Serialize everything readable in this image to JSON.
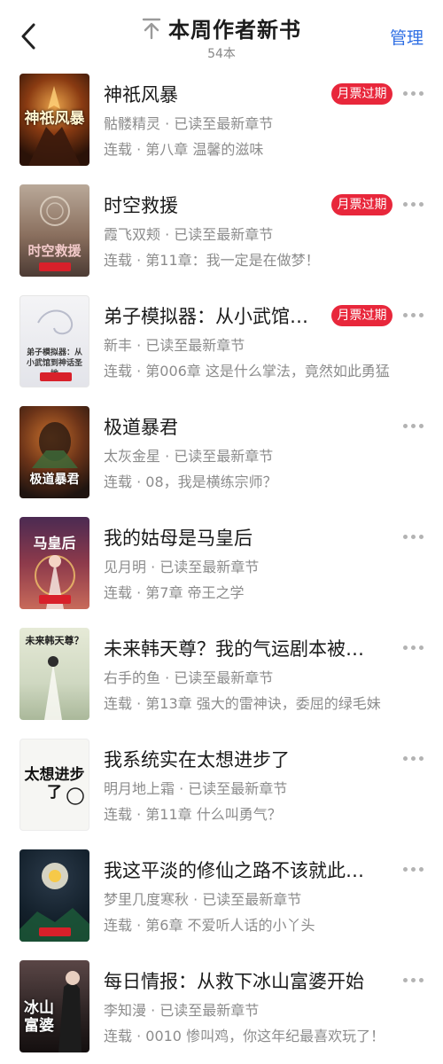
{
  "header": {
    "back_icon": "chevron-left-icon",
    "pin_icon": "pin-to-top-icon",
    "title": "本周作者新书",
    "subtitle": "54本",
    "manage_label": "管理"
  },
  "colors": {
    "accent": "#2f6fe4",
    "badge_red": "#e8273b",
    "meta_gray": "#8c8c8c"
  },
  "books": [
    {
      "title": "神祇风暴",
      "author": "骷髅精灵",
      "status": "已读至最新章节",
      "latest": "连载 · 第八章  温馨的滋味",
      "badge": "月票过期",
      "cover_title": "神祇风暴"
    },
    {
      "title": "时空救援",
      "author": "霞飞双颊",
      "status": "已读至最新章节",
      "latest": "连载 · 第11章：我一定是在做梦！",
      "badge": "月票过期",
      "cover_title": "时空救援"
    },
    {
      "title": "弟子模拟器：从小武馆到神话圣地",
      "author": "新丰",
      "status": "已读至最新章节",
      "latest": "连载 · 第006章 这是什么掌法，竟然如此勇猛",
      "badge": "月票过期",
      "cover_title": "弟子模拟器：从小武馆到神话圣地"
    },
    {
      "title": "极道暴君",
      "author": "太灰金星",
      "status": "已读至最新章节",
      "latest": "连载 · 08，我是横练宗师？",
      "badge": "",
      "cover_title": "极道暴君"
    },
    {
      "title": "我的姑母是马皇后",
      "author": "见月明",
      "status": "已读至最新章节",
      "latest": "连载 · 第7章  帝王之学",
      "badge": "",
      "cover_title": "马皇后"
    },
    {
      "title": "未来韩天尊？我的气运剧本被篡改",
      "author": "右手的鱼",
      "status": "已读至最新章节",
      "latest": "连载 · 第13章 强大的雷神诀，委屈的绿毛妹",
      "badge": "",
      "cover_title": "未来韩天尊？"
    },
    {
      "title": "我系统实在太想进步了",
      "author": "明月地上霜",
      "status": "已读至最新章节",
      "latest": "连载 · 第11章 什么叫勇气？",
      "badge": "",
      "cover_title": "太想进步了"
    },
    {
      "title": "我这平淡的修仙之路不该就此结束",
      "author": "梦里几度寒秋",
      "status": "已读至最新章节",
      "latest": "连载 · 第6章 不爱听人话的小丫头",
      "badge": "",
      "cover_title": ""
    },
    {
      "title": "每日情报：从救下冰山富婆开始",
      "author": "李知漫",
      "status": "已读至最新章节",
      "latest": "连载 · 0010 惨叫鸡，你这年纪最喜欢玩了！",
      "badge": "",
      "cover_title": "冰山富婆"
    }
  ]
}
